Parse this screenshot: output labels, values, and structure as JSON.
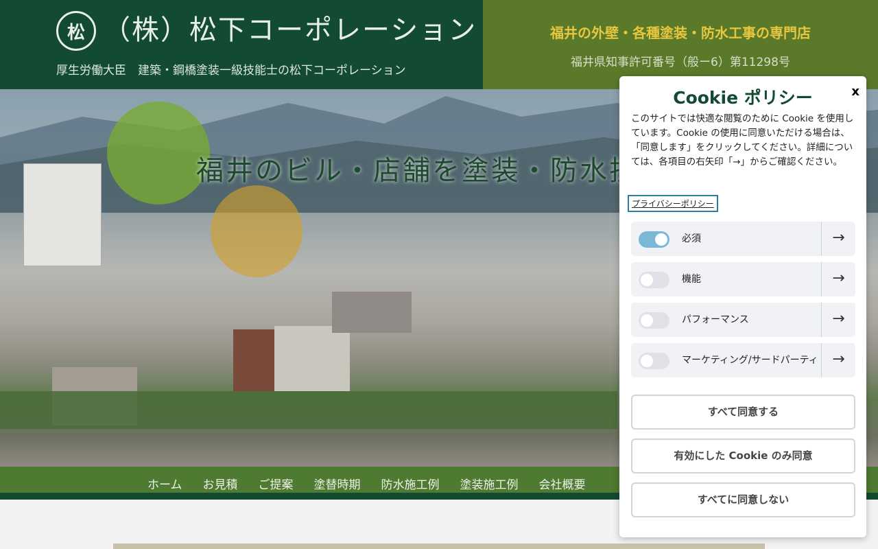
{
  "header": {
    "logo_glyph": "松",
    "company_name": "（株）松下コーポレーション",
    "company_sub": "厚生労働大臣　建築・鋼橋塗装一級技能士の松下コーポレーション",
    "tagline": "福井の外壁・各種塗装・防水工事の専門店",
    "license": "福井県知事許可番号（般ー6）第11298号"
  },
  "hero": {
    "title": "福井のビル・店舗を塗装・防水技"
  },
  "nav": {
    "items": [
      "ホーム",
      "お見積",
      "ご提案",
      "塗替時期",
      "防水施工例",
      "塗装施工例",
      "会社概要"
    ]
  },
  "cookie": {
    "title": "Cookie ポリシー",
    "close": "x",
    "description": "このサイトでは快適な閲覧のために Cookie を使用しています。Cookie の使用に同意いただける場合は、「同意します」をクリックしてください。詳細については、各項目の右矢印「→」からご確認ください。",
    "privacy_link": "プライバシーポリシー",
    "categories": [
      {
        "label": "必須",
        "enabled": true
      },
      {
        "label": "機能",
        "enabled": false
      },
      {
        "label": "パフォーマンス",
        "enabled": false
      },
      {
        "label": "マーケティング/サードパーティ",
        "enabled": false
      }
    ],
    "arrow": "→",
    "buttons": {
      "accept_all": "すべて同意する",
      "accept_selected": "有効にした Cookie のみ同意",
      "reject_all": "すべてに同意しない"
    }
  },
  "colors": {
    "header_dark_green": "#124a32",
    "header_olive": "#5a7a2a",
    "tagline_gold": "#e8c640",
    "nav_green": "#4f7a32",
    "toggle_on": "#7ab8d8"
  }
}
